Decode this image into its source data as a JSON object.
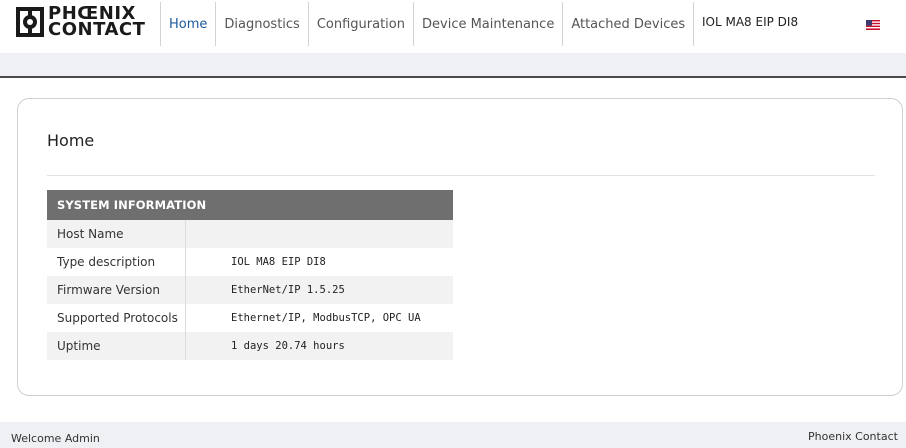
{
  "logo": {
    "line1": "PHŒNIX",
    "line2": "CONTACT"
  },
  "nav": {
    "tabs": [
      {
        "label": "Home",
        "active": true
      },
      {
        "label": "Diagnostics",
        "active": false
      },
      {
        "label": "Configuration",
        "active": false
      },
      {
        "label": "Device Maintenance",
        "active": false
      },
      {
        "label": "Attached Devices",
        "active": false
      }
    ],
    "device_name": "IOL MA8 EIP DI8",
    "language_flag": "us-flag-icon"
  },
  "main": {
    "title": "Home",
    "system_information": {
      "header": "SYSTEM INFORMATION",
      "rows": [
        {
          "key": "Host Name",
          "value": ""
        },
        {
          "key": "Type description",
          "value": "IOL MA8 EIP DI8"
        },
        {
          "key": "Firmware Version",
          "value": "EtherNet/IP 1.5.25"
        },
        {
          "key": "Supported Protocols",
          "value": "Ethernet/IP, ModbusTCP, OPC UA"
        },
        {
          "key": "Uptime",
          "value": "1 days 20.74 hours"
        }
      ]
    }
  },
  "footer": {
    "welcome": "Welcome Admin",
    "brand": "Phoenix Contact"
  },
  "colors": {
    "active_tab": "#1c5a9c",
    "table_header": "#6f6f6f",
    "bar_bg": "#eff0f4"
  }
}
